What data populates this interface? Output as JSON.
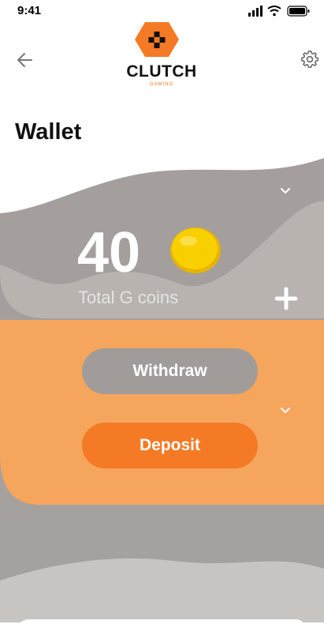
{
  "status_bar": {
    "time": "9:41"
  },
  "header": {
    "logo_text": "CLUTCH",
    "logo_subtext": "GAMING"
  },
  "page_title": "Wallet",
  "balance": {
    "amount": "40",
    "label": "Total G coins"
  },
  "actions": {
    "withdraw_label": "Withdraw",
    "deposit_label": "Deposit"
  },
  "colors": {
    "accent": "#f47a25",
    "accent_light": "#f6a55c",
    "grey_dark": "#a19c99",
    "grey_light": "#b8b4b1",
    "coin": "#f8d000"
  },
  "icons": [
    "back-arrow-icon",
    "settings-gear-icon",
    "gamepad-logo-icon",
    "chevron-down-icon",
    "coin-icon",
    "plus-icon",
    "signal-icon",
    "wifi-icon",
    "battery-icon"
  ]
}
